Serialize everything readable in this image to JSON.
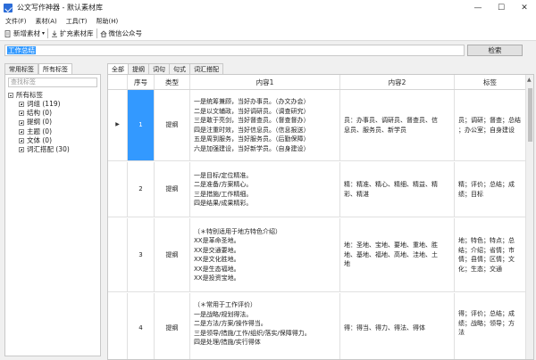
{
  "window": {
    "title": "公文写作神器 - 默认素材库",
    "controls": [
      "—",
      "☐",
      "✕"
    ]
  },
  "menu": [
    "文件(F)",
    "素材(A)",
    "工具(T)",
    "帮助(H)"
  ],
  "toolbar": {
    "new_material": "新增素材",
    "dropdown": "▾",
    "expand_library": "扩充素材库",
    "wechat": "微信公众号"
  },
  "search": {
    "value": "工作总结",
    "button": "检索"
  },
  "left_panel": {
    "tabs": [
      "常用标签",
      "所有标签"
    ],
    "filter_placeholder": "查找标签",
    "root": "所有标签",
    "nodes": [
      "词组 (119)",
      "结构 (0)",
      "提纲 (0)",
      "主题 (0)",
      "文体 (0)",
      "词汇搭配 (30)"
    ]
  },
  "right_panel": {
    "tabs": [
      "全部",
      "提纲",
      "词句",
      "句式",
      "词汇搭配"
    ]
  },
  "grid": {
    "columns": [
      "序号",
      "类型",
      "内容1",
      "内容2",
      "标签"
    ],
    "rows": [
      {
        "index": "1",
        "type": "提纲",
        "content1": [
          "一是统筹兼顾，当好办事员。（办文办会）",
          "二是以文辅政，当好调研员。（调查研究）",
          "三是敢于亮剑，当好督查员。（督查督办）",
          "四是注重时效，当好信息员。（信息报送）",
          "五是周到服务，当好服务员。（后勤保障）",
          "六是加强建设，当好新学员。（自身建设）"
        ],
        "content2": [
          "员：办事员、调研员、督查员、信",
          "息员、服务员、新学员"
        ],
        "tags": [
          "员；调研；督查；总结",
          "；办公室；自身建设"
        ]
      },
      {
        "index": "2",
        "type": "提纲",
        "content1": [
          "一是目标/定位精准。",
          "二是准备/方案精心。",
          "三是措施/工作精细。",
          "四是结果/成果精彩。"
        ],
        "content2": [
          "精：精准、精心、精细、精益、精",
          "彩、精湛"
        ],
        "tags": [
          "精；评价；总结；成",
          "绩；目标"
        ]
      },
      {
        "index": "3",
        "type": "提纲",
        "content1": [
          "（＊特别适用于地方特色介绍）",
          "XX是革命圣地。",
          "XX是交通要地。",
          "XX是文化胜地。",
          "XX是生态福地。",
          "XX是投资宝地。"
        ],
        "content2": [
          "地：圣地、宝地、要地、重地、胜",
          "地、基地、福地、高地、洼地、土",
          "地"
        ],
        "tags": [
          "地；特色；特点；总",
          "结；介绍；省情；市",
          "情；县情；区情；文",
          "化；生态；交通"
        ]
      },
      {
        "index": "4",
        "type": "提纲",
        "content1": [
          "（＊常用于工作评价）",
          "一是战略/规划得法。",
          "二是方法/方案/操作得当。",
          "三是领导/措施/工作/组织/落实/保障得力。",
          "四是处理/措施/实行得体"
        ],
        "content2": [
          "得：得当、得力、得法、得体"
        ],
        "tags": [
          "得；评价；总结；成",
          "绩；战略；领导；方",
          "法"
        ]
      }
    ]
  }
}
